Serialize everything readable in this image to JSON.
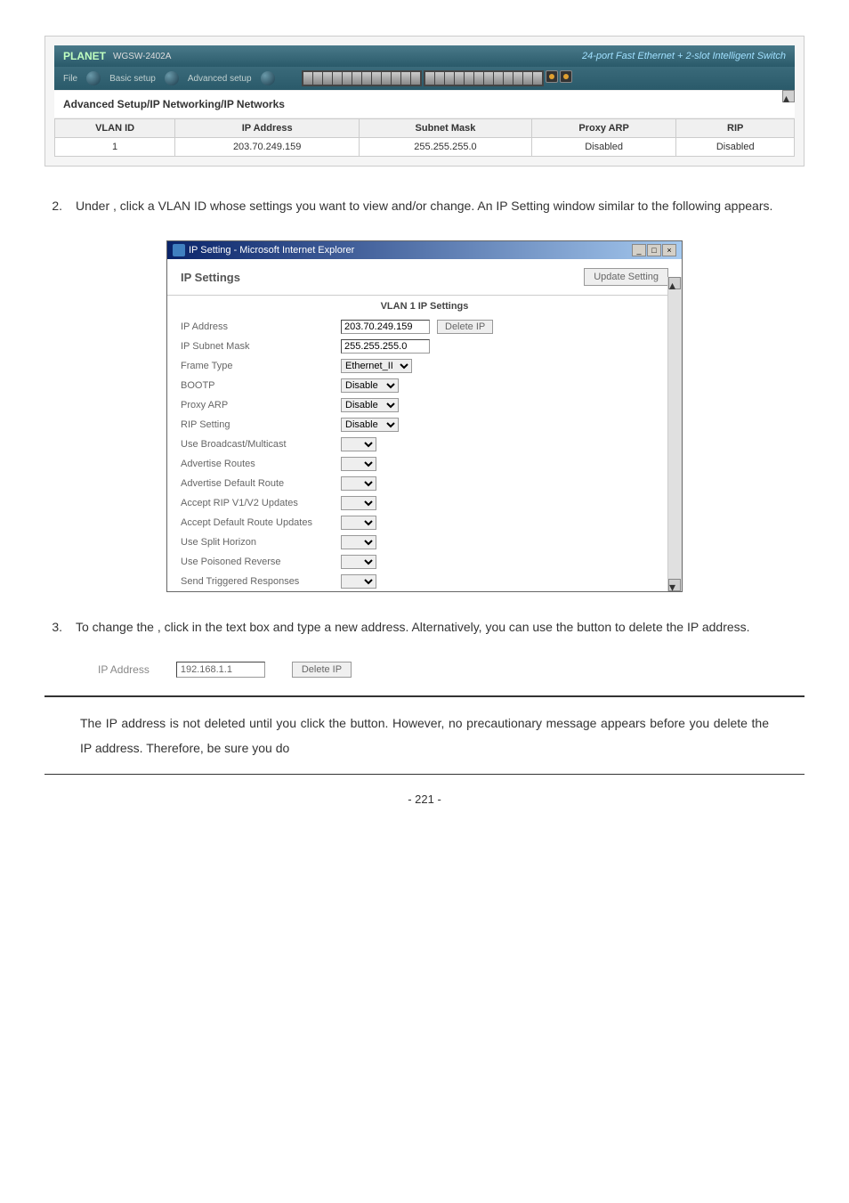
{
  "screenshot1": {
    "logo": "PLANET",
    "model": "WGSW-2402A",
    "slogan": "24-port Fast Ethernet + 2-slot Intelligent Switch",
    "nav": {
      "file": "File",
      "basic": "Basic setup",
      "advanced": "Advanced setup"
    },
    "section_title": "Advanced Setup/IP Networking/IP Networks",
    "table": {
      "headers": [
        "VLAN ID",
        "IP Address",
        "Subnet Mask",
        "Proxy ARP",
        "RIP"
      ],
      "row": [
        "1",
        "203.70.249.159",
        "255.255.255.0",
        "Disabled",
        "Disabled"
      ]
    }
  },
  "step2": {
    "num": "2.",
    "text_before": "Under ",
    "text_after": ", click a VLAN ID whose settings you want to view and/or change. An IP Setting window similar to the following appears."
  },
  "ip_window": {
    "title": "IP Setting - Microsoft Internet Explorer",
    "header": "IP Settings",
    "update_btn": "Update Setting",
    "vlan_title": "VLAN 1 IP Settings",
    "rows": {
      "ip_address": {
        "label": "IP Address",
        "value": "203.70.249.159",
        "btn": "Delete IP"
      },
      "subnet": {
        "label": "IP Subnet Mask",
        "value": "255.255.255.0"
      },
      "frame_type": {
        "label": "Frame Type",
        "value": "Ethernet_II"
      },
      "bootp": {
        "label": "BOOTP",
        "value": "Disable"
      },
      "proxy_arp": {
        "label": "Proxy ARP",
        "value": "Disable"
      },
      "rip": {
        "label": "RIP Setting",
        "value": "Disable"
      },
      "broadcast": {
        "label": "Use Broadcast/Multicast",
        "value": ""
      },
      "adv_routes": {
        "label": "Advertise Routes",
        "value": ""
      },
      "adv_default": {
        "label": "Advertise Default Route",
        "value": ""
      },
      "accept_rip": {
        "label": "Accept RIP V1/V2 Updates",
        "value": ""
      },
      "accept_default": {
        "label": "Accept Default Route Updates",
        "value": ""
      },
      "split_horizon": {
        "label": "Use Split Horizon",
        "value": ""
      },
      "poisoned": {
        "label": "Use Poisoned Reverse",
        "value": ""
      },
      "triggered": {
        "label": "Send Triggered Responses",
        "value": ""
      }
    }
  },
  "step3": {
    "num": "3.",
    "text1": "To change the ",
    "text2": ", click in the text box and type a new address. Alternatively, you can use the ",
    "text3": " button to delete the IP address."
  },
  "standalone": {
    "label": "IP Address",
    "value": "192.168.1.1",
    "btn": "Delete IP"
  },
  "note": {
    "text1": "The IP address is not deleted until you click the ",
    "text2": " button. However, no precautionary message appears before you delete the IP address. Therefore, be sure you do"
  },
  "page": "- 221 -"
}
